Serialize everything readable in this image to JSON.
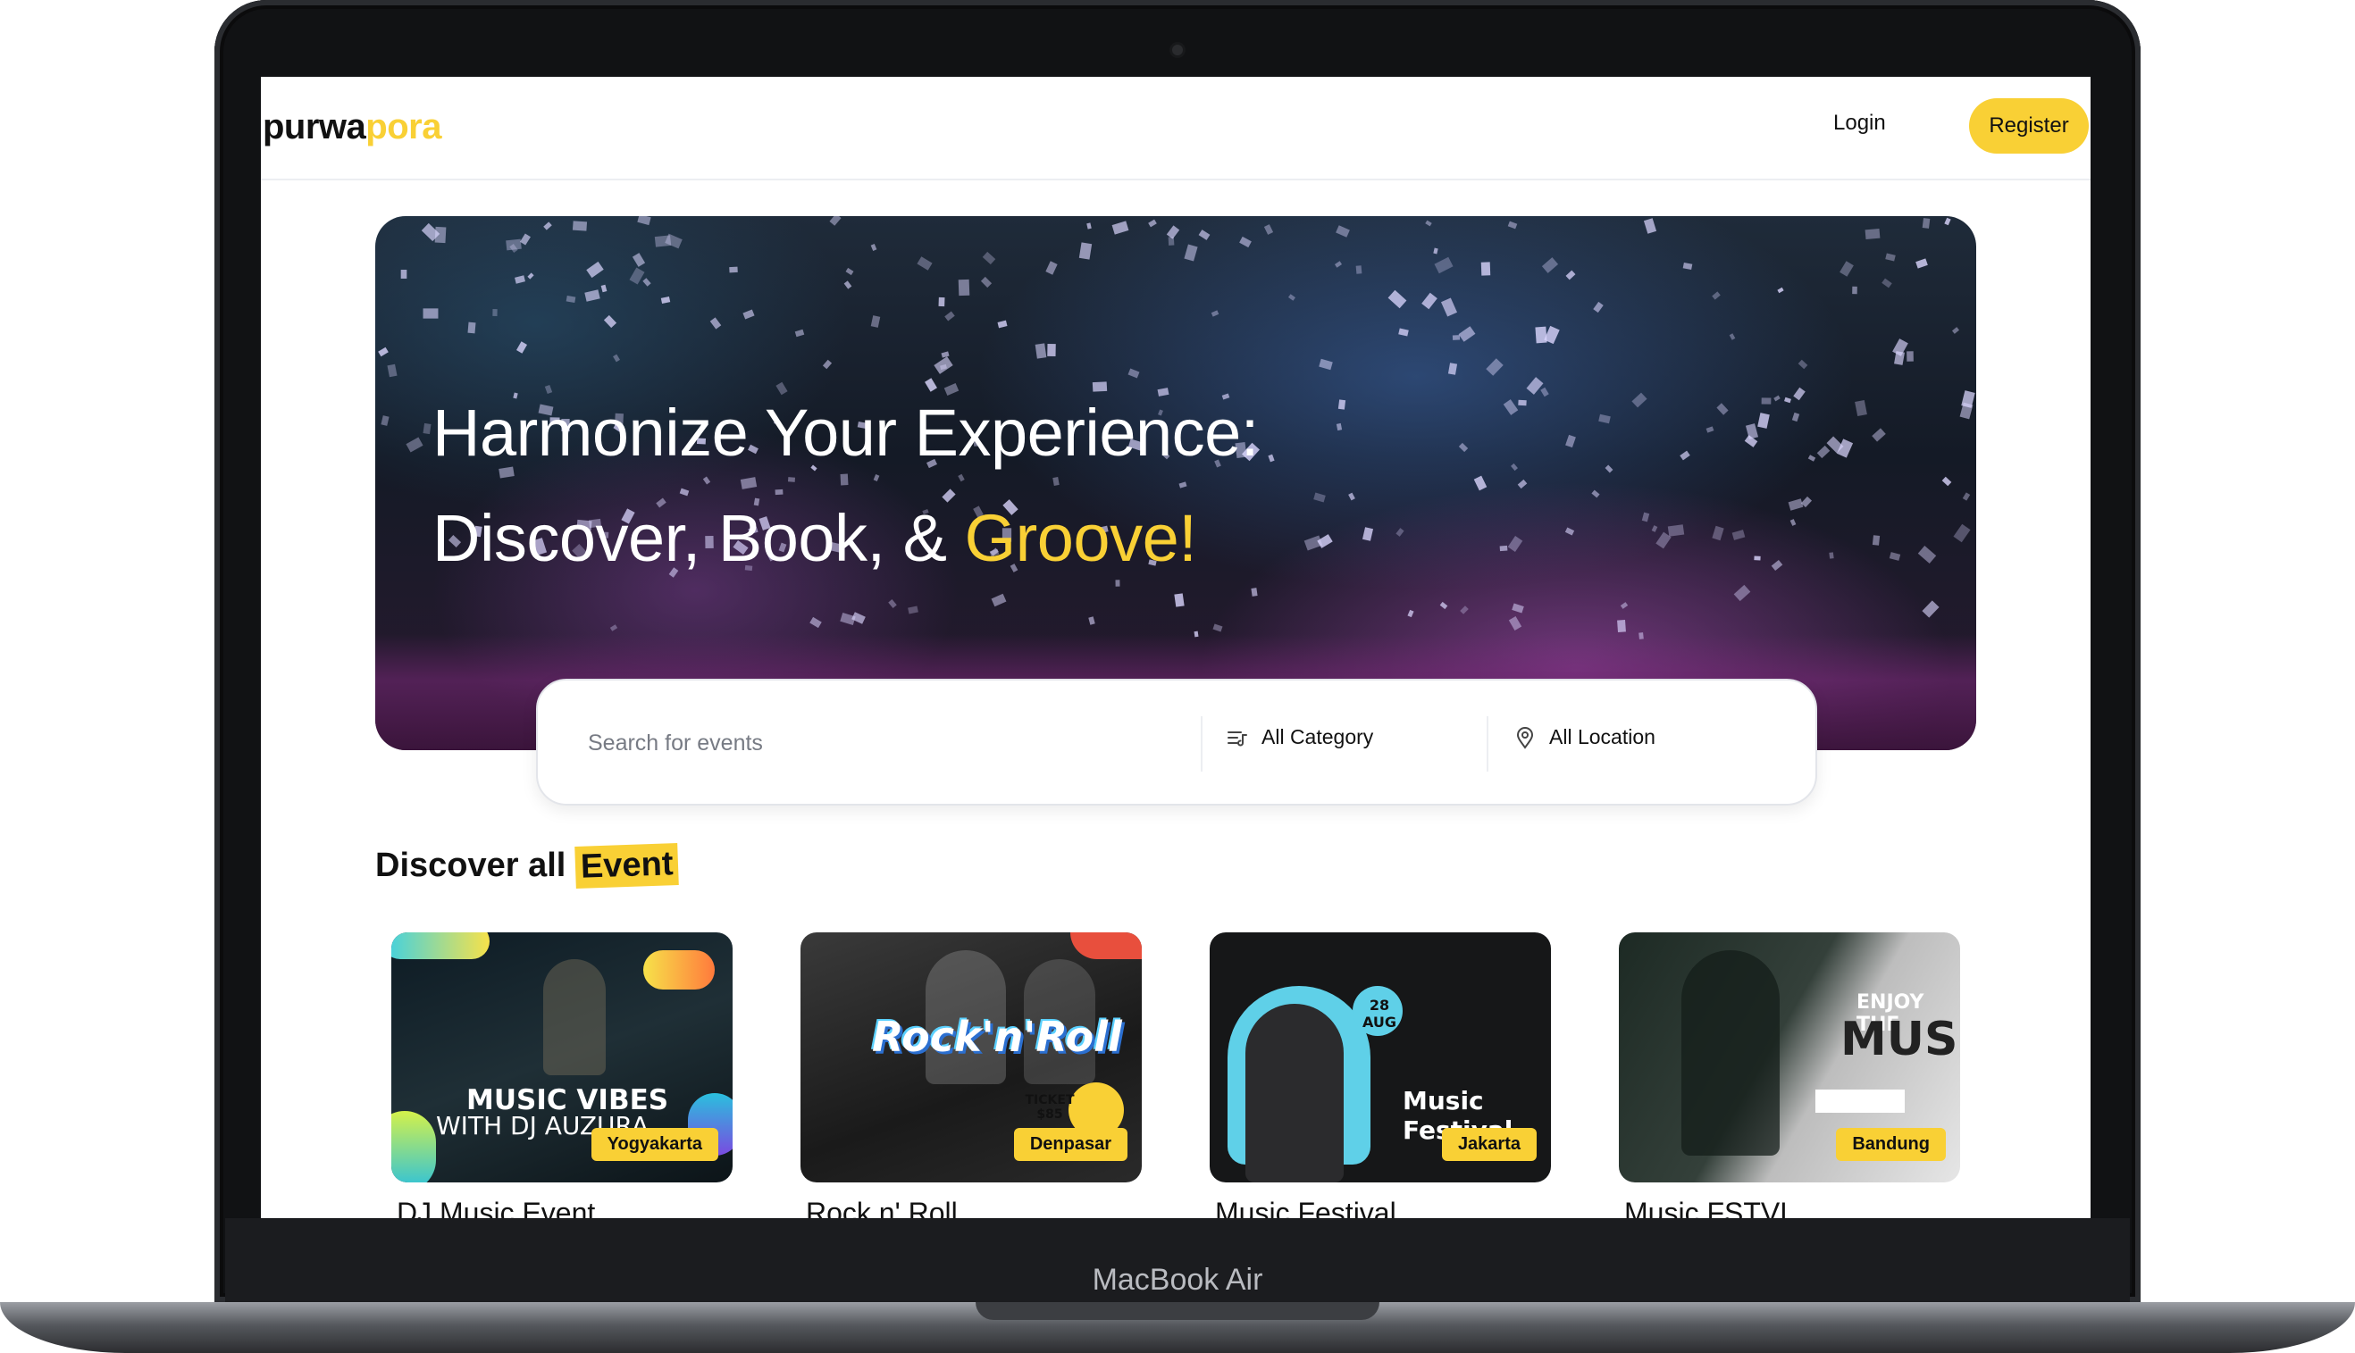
{
  "device": {
    "label": "MacBook Air"
  },
  "header": {
    "logo_part1": "purwa",
    "logo_part2": "pora",
    "login_label": "Login",
    "register_label": "Register"
  },
  "hero": {
    "line1": "Harmonize Your Experience:",
    "line2_prefix": "Discover, Book, & ",
    "line2_highlight": "Groove!"
  },
  "search": {
    "placeholder": "Search for events",
    "category_label": "All Category",
    "location_label": "All Location"
  },
  "discover": {
    "title_prefix": "Discover all ",
    "title_highlight": "Event"
  },
  "events": [
    {
      "title": "DJ Music Event",
      "location": "Yogyakarta",
      "poster_line1": "MUSIC VIBES",
      "poster_line2": "WITH DJ AUZURA"
    },
    {
      "title": "Rock n' Roll",
      "location": "Denpasar",
      "poster_line1": "Rock'n'Roll",
      "poster_line2": "TICKET $85"
    },
    {
      "title": "Music Festival",
      "location": "Jakarta",
      "poster_line1": "Music Festival",
      "poster_line2": "28 AUG"
    },
    {
      "title": "Music FSTVL",
      "location": "Bandung",
      "poster_line1": "ENJOY THE",
      "poster_line2": "MUSIC"
    }
  ],
  "colors": {
    "accent": "#f9d035",
    "text": "#111111"
  }
}
